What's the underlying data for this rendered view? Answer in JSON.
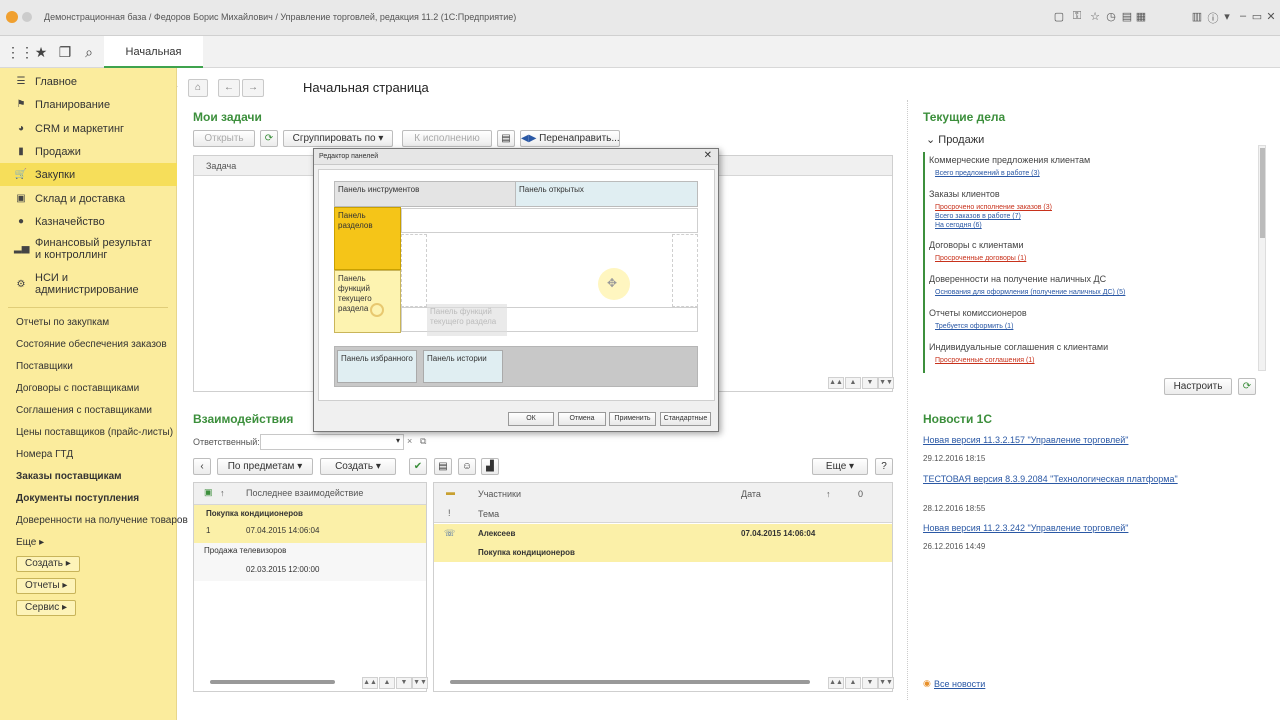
{
  "window": {
    "title": "Демонстрационная база / Федоров Борис Михайлович / Управление торговлей, редакция 11.2  (1С:Предприятие)"
  },
  "tabbar": {
    "home_tab": "Начальная страница"
  },
  "sidebar": {
    "sections": [
      {
        "label": "Главное",
        "icon": "menu-icon"
      },
      {
        "label": "Планирование",
        "icon": "planning-icon"
      },
      {
        "label": "CRM и маркетинг",
        "icon": "pie-icon"
      },
      {
        "label": "Продажи",
        "icon": "bag-icon"
      },
      {
        "label": "Закупки",
        "icon": "cart-icon"
      },
      {
        "label": "Склад и доставка",
        "icon": "warehouse-icon"
      },
      {
        "label": "Казначейство",
        "icon": "coins-icon"
      },
      {
        "label": "Финансовый результат и контроллинг",
        "icon": "chart-icon"
      },
      {
        "label": "НСИ и администрирование",
        "icon": "gear-icon"
      }
    ],
    "links": [
      "Отчеты по закупкам",
      "Состояние обеспечения заказов",
      "Поставщики",
      "Договоры с поставщиками",
      "Соглашения с поставщиками",
      "Цены поставщиков (прайс-листы)",
      "Номера ГТД",
      "Заказы поставщикам",
      "Документы поступления",
      "Доверенности на получение товаров",
      "Еще"
    ],
    "buttons": [
      "Создать",
      "Отчеты",
      "Сервис"
    ]
  },
  "page": {
    "title": "Начальная страница"
  },
  "tasks": {
    "heading": "Мои задачи",
    "open_btn": "Открыть",
    "group_btn": "Сгруппировать по",
    "exec_btn": "К исполнению",
    "redirect_btn": "Перенаправить...",
    "col_task": "Задача"
  },
  "interactions": {
    "heading": "Взаимодействия",
    "responsible_label": "Ответственный:",
    "by_subject_btn": "По предметам",
    "create_btn": "Создать",
    "more_btn": "Еще",
    "help_btn": "?",
    "left_cols": {
      "arrow": "↑",
      "last": "Последнее взаимодействие"
    },
    "left_rows": [
      {
        "title": "Покупка кондиционеров",
        "num": "1",
        "date": "07.04.2015 14:06:04"
      },
      {
        "title": "Продажа телевизоров",
        "date": "02.03.2015 12:00:00"
      }
    ],
    "right_cols": {
      "participants": "Участники",
      "date": "Дата",
      "arrow": "↑",
      "topic": "Тема",
      "excl": "!",
      "clip": "0"
    },
    "right_row": {
      "participant": "Алексеев",
      "date": "07.04.2015 14:06:04",
      "topic": "Покупка кондиционеров"
    }
  },
  "current": {
    "heading": "Текущие дела",
    "group": "Продажи",
    "items": [
      {
        "cat": "Коммерческие предложения клиентам",
        "links": [
          {
            "t": "Всего предложений в работе (3)",
            "red": false
          }
        ]
      },
      {
        "cat": "Заказы клиентов",
        "links": [
          {
            "t": "Просрочено исполнение заказов (3)",
            "red": true
          },
          {
            "t": "Всего заказов в работе (7)",
            "red": false
          },
          {
            "t": "На сегодня (6)",
            "red": false
          }
        ]
      },
      {
        "cat": "Договоры с клиентами",
        "links": [
          {
            "t": "Просроченные договоры (1)",
            "red": true
          }
        ]
      },
      {
        "cat": "Доверенности на получение наличных ДС",
        "links": [
          {
            "t": "Основания для оформления (получение наличных ДС) (5)",
            "red": false
          }
        ]
      },
      {
        "cat": "Отчеты комиссионеров",
        "links": [
          {
            "t": "Требуется оформить (1)",
            "red": false
          }
        ]
      },
      {
        "cat": "Индивидуальные соглашения с клиентами",
        "links": [
          {
            "t": "Просроченные соглашения (1)",
            "red": true
          }
        ]
      }
    ],
    "configure_btn": "Настроить"
  },
  "news": {
    "heading": "Новости 1С",
    "items": [
      {
        "title": "Новая версия 11.3.2.157 \"Управление торговлей\"",
        "date": "29.12.2016 18:15"
      },
      {
        "title": "ТЕСТОВАЯ версия 8.3.9.2084 \"Технологическая платформа\"",
        "date": "28.12.2016 18:55"
      },
      {
        "title": "Новая версия 11.2.3.242 \"Управление торговлей\"",
        "date": "26.12.2016 14:49"
      }
    ],
    "all": "Все новости"
  },
  "dialog": {
    "title": "Редактор панелей",
    "toolbar_panel": "Панель инструментов",
    "open_panel": "Панель открытых",
    "sections_panel": "Панель разделов",
    "functions_panel": "Панель функций текущего раздела",
    "drag_ghost": "Панель функций текущего раздела",
    "favorites_panel": "Панель избранного",
    "history_panel": "Панель истории",
    "ok": "ОК",
    "cancel": "Отмена",
    "apply": "Применить",
    "standard": "Стандартные"
  },
  "colors": {
    "sidebar": "#fbec9d",
    "accent_green": "#3c8f3c",
    "selected_row": "#fbf0a8",
    "link_blue": "#2a58a5",
    "link_red": "#c8321c"
  }
}
